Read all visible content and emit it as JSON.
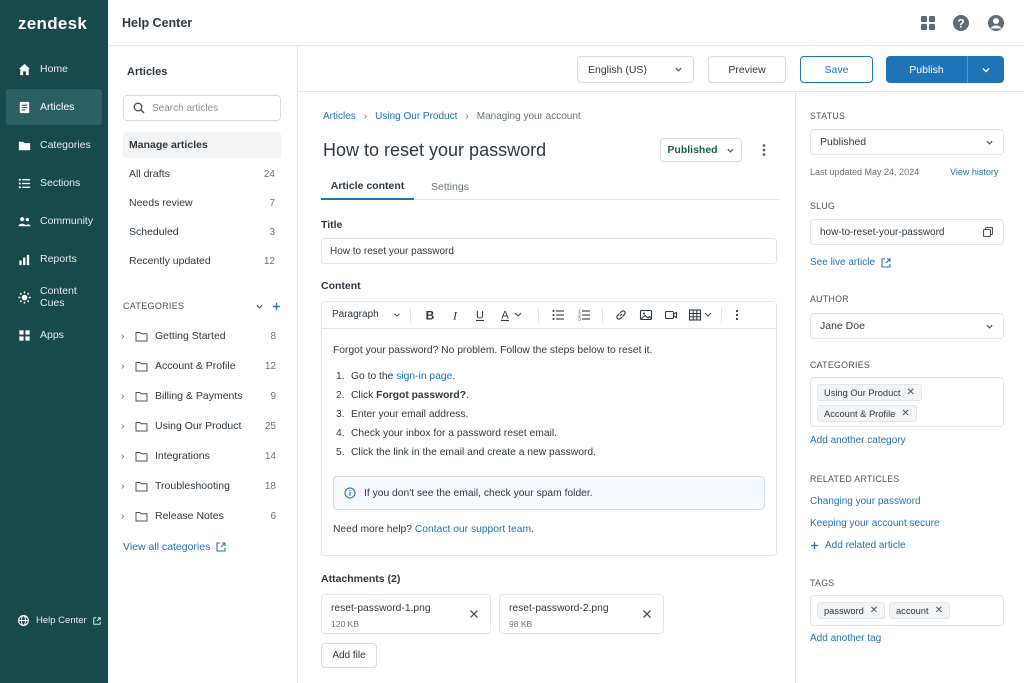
{
  "app": {
    "logo": "zendesk",
    "product": "Help Center"
  },
  "nav": {
    "items": [
      {
        "label": "Home",
        "icon": "home-icon"
      },
      {
        "label": "Articles",
        "icon": "article-icon",
        "active": true
      },
      {
        "label": "Categories",
        "icon": "folder-icon"
      },
      {
        "label": "Sections",
        "icon": "list-icon"
      },
      {
        "label": "Community",
        "icon": "community-icon"
      },
      {
        "label": "Reports",
        "icon": "bar-chart-icon"
      },
      {
        "label": "Content Cues",
        "icon": "content-cues-icon"
      },
      {
        "label": "Apps",
        "icon": "apps-grid-icon"
      }
    ],
    "footer_link": "Help Center"
  },
  "topbar_icons": [
    "apps-grid-icon",
    "help-icon",
    "user-avatar-icon"
  ],
  "sidebar": {
    "heading": "Articles",
    "search_placeholder": "Search articles",
    "manage": "Manage articles",
    "views": [
      {
        "label": "All drafts",
        "count": "24"
      },
      {
        "label": "Needs review",
        "count": "7"
      },
      {
        "label": "Scheduled",
        "count": "3"
      },
      {
        "label": "Recently updated",
        "count": "12"
      }
    ],
    "categories_heading": "CATEGORIES",
    "categories": [
      {
        "label": "Getting Started",
        "count": "8"
      },
      {
        "label": "Account & Profile",
        "count": "12"
      },
      {
        "label": "Billing & Payments",
        "count": "9"
      },
      {
        "label": "Using Our Product",
        "count": "25"
      },
      {
        "label": "Integrations",
        "count": "14"
      },
      {
        "label": "Troubleshooting",
        "count": "18"
      },
      {
        "label": "Release Notes",
        "count": "6"
      }
    ],
    "view_all": "View all categories"
  },
  "toolbar": {
    "language": "English (US)",
    "preview": "Preview",
    "save": "Save",
    "publish": "Publish"
  },
  "editor": {
    "breadcrumbs": [
      "Articles",
      "Using Our Product",
      "Managing your account"
    ],
    "title": "How to reset your password",
    "status": "Published",
    "tabs": [
      "Article content",
      "Settings"
    ],
    "title_label": "Title",
    "title_value": "How to reset your password",
    "content_label": "Content",
    "paragraph_style": "Paragraph",
    "body": {
      "intro": "Forgot your password? No problem. Follow the steps below to reset it.",
      "steps": [
        {
          "n": "1.",
          "pre": "Go to the ",
          "link": "sign-in page",
          "post": "."
        },
        {
          "n": "2.",
          "pre": "Click ",
          "bold": "Forgot password?",
          "post": "."
        },
        {
          "n": "3.",
          "pre": "Enter your email address."
        },
        {
          "n": "4.",
          "pre": "Check your inbox for a password reset email."
        },
        {
          "n": "5.",
          "pre": "Click the link in the email and create a new password."
        }
      ],
      "callout": "If you don't see the email, check your spam folder.",
      "help_pre": "Need more help? ",
      "help_link": "Contact our support team",
      "help_post": "."
    },
    "attachments_label": "Attachments (2)",
    "attachments": [
      {
        "name": "reset-password-1.png",
        "size": "120 KB"
      },
      {
        "name": "reset-password-2.png",
        "size": "98 KB"
      }
    ],
    "add_file": "Add file"
  },
  "panel": {
    "status_label": "STATUS",
    "status_value": "Published",
    "last_updated": "Last updated May 24, 2024",
    "view_history": "View history",
    "slug_label": "SLUG",
    "slug_value": "how-to-reset-your-password",
    "see_live": "See live article",
    "author_label": "AUTHOR",
    "author_value": "Jane Doe",
    "categories_label": "CATEGORIES",
    "categories": [
      "Using Our Product",
      "Account & Profile"
    ],
    "add_category": "Add another category",
    "related_label": "RELATED ARTICLES",
    "related": [
      "Changing your password",
      "Keeping your account secure"
    ],
    "add_related": "Add related article",
    "tags_label": "TAGS",
    "tags": [
      "password",
      "account"
    ],
    "add_tag": "Add another tag"
  },
  "colors": {
    "nav_bg": "#17494d",
    "accent": "#1f73b7",
    "published_green": "#186146"
  }
}
